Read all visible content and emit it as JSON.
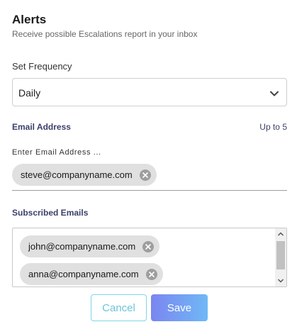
{
  "header": {
    "title": "Alerts",
    "subtitle": "Receive possible Escalations report in your inbox"
  },
  "frequency": {
    "label": "Set Frequency",
    "value": "Daily",
    "chevron_icon": "chevron-down-icon"
  },
  "email": {
    "label": "Email Address",
    "limit_text": "Up to 5",
    "input_label": "Enter Email Address ...",
    "chips": [
      {
        "email": "steve@companyname.com",
        "remove_icon": "close-circle-icon"
      }
    ]
  },
  "subscribed": {
    "label": "Subscribed Emails",
    "items": [
      {
        "email": "john@companyname.com",
        "remove_icon": "close-circle-icon"
      },
      {
        "email": "anna@companyname.com",
        "remove_icon": "close-circle-icon"
      }
    ]
  },
  "actions": {
    "cancel_label": "Cancel",
    "save_label": "Save"
  },
  "colors": {
    "label_accent": "#3b3f6b",
    "chip_bg": "#e0e0e0",
    "cancel_border": "#7fd6e6",
    "save_gradient_start": "#7b86f0",
    "save_gradient_end": "#6fb8f6"
  }
}
